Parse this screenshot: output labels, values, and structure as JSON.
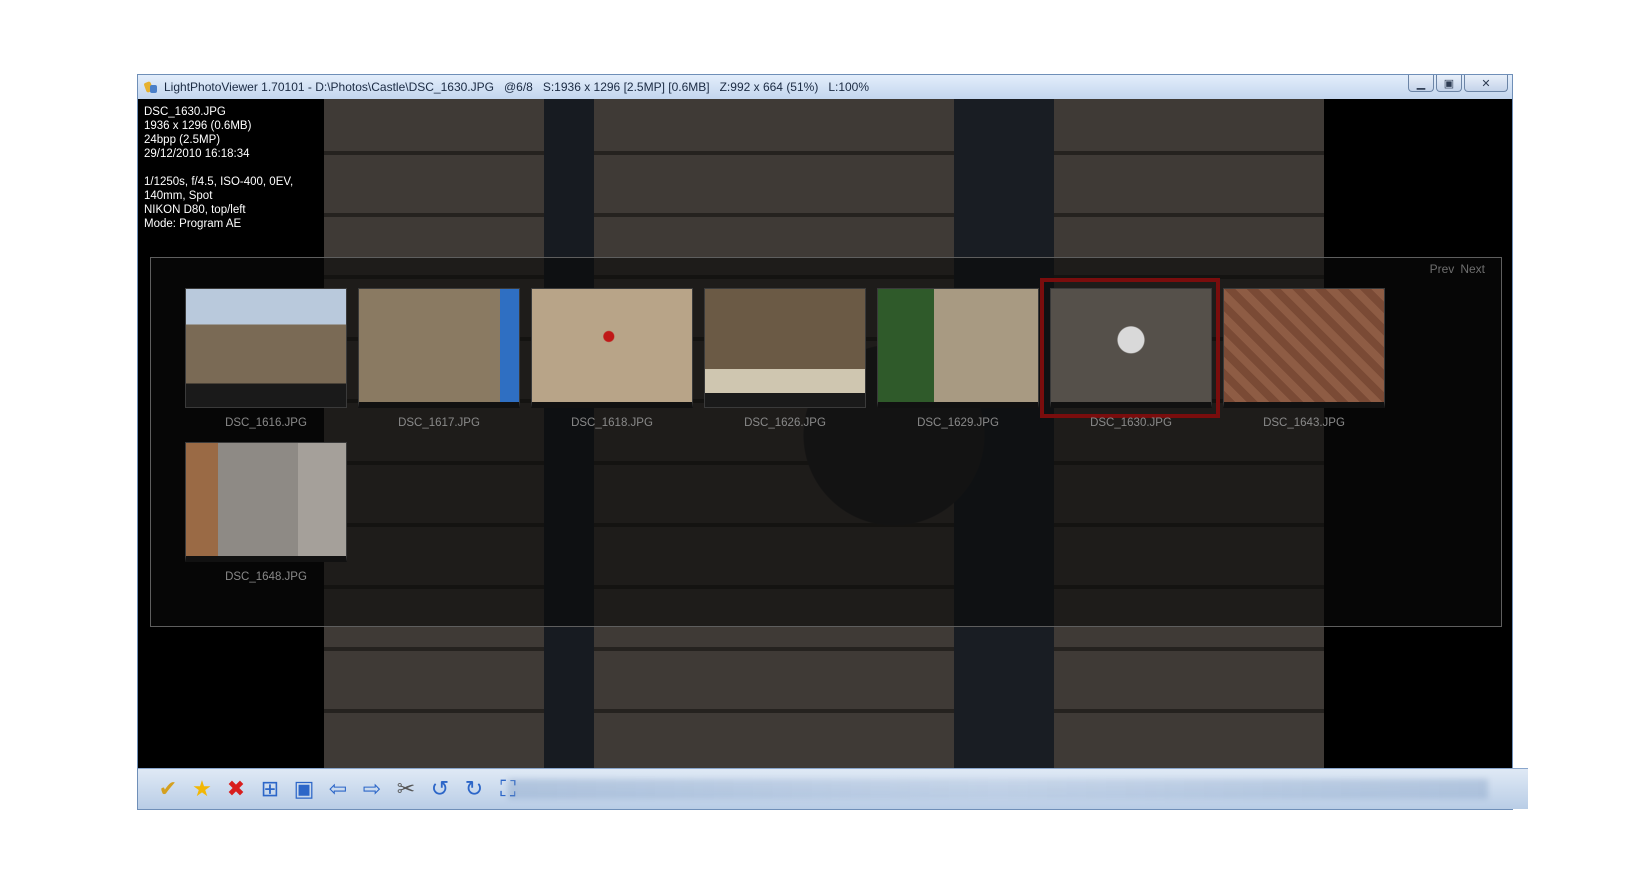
{
  "window": {
    "title": "LightPhotoViewer 1.70101 - D:\\Photos\\Castle\\DSC_1630.JPG   @6/8   S:1936 x 1296 [2.5MP] [0.6MB]   Z:992 x 664 (51%)   L:100%",
    "minimize": "▁",
    "maximize": "▣",
    "close": "✕"
  },
  "info": {
    "lines": [
      "DSC_1630.JPG",
      "1936 x 1296 (0.6MB)",
      "24bpp (2.5MP)",
      "29/12/2010 16:18:34",
      "",
      "1/1250s, f/4.5, ISO-400, 0EV,",
      "140mm, Spot",
      "NIKON D80, top/left",
      "Mode: Program AE"
    ]
  },
  "gallery": {
    "prev": "Prev",
    "next": "Next",
    "thumbs": [
      {
        "name": "DSC_1616.JPG",
        "selected": false
      },
      {
        "name": "DSC_1617.JPG",
        "selected": false
      },
      {
        "name": "DSC_1618.JPG",
        "selected": false
      },
      {
        "name": "DSC_1626.JPG",
        "selected": false
      },
      {
        "name": "DSC_1629.JPG",
        "selected": false
      },
      {
        "name": "DSC_1630.JPG",
        "selected": true
      },
      {
        "name": "DSC_1643.JPG",
        "selected": false
      },
      {
        "name": "DSC_1648.JPG",
        "selected": false
      }
    ]
  },
  "toolbar": {
    "icons": [
      {
        "name": "shield-check-icon",
        "glyph": "✔",
        "color": "#d4a020"
      },
      {
        "name": "star-icon",
        "glyph": "★",
        "color": "#f2b705"
      },
      {
        "name": "delete-icon",
        "glyph": "✖",
        "color": "#d81e1e"
      },
      {
        "name": "grid-icon",
        "glyph": "⊞",
        "color": "#2c66c8"
      },
      {
        "name": "image-icon",
        "glyph": "▣",
        "color": "#2c66c8"
      },
      {
        "name": "arrow-left-icon",
        "glyph": "⇦",
        "color": "#2c66c8"
      },
      {
        "name": "arrow-right-icon",
        "glyph": "⇨",
        "color": "#2c66c8"
      },
      {
        "name": "tools-icon",
        "glyph": "✂",
        "color": "#555555"
      },
      {
        "name": "rotate-left-icon",
        "glyph": "↺",
        "color": "#2c66c8"
      },
      {
        "name": "rotate-right-icon",
        "glyph": "↻",
        "color": "#2c66c8"
      },
      {
        "name": "fit-screen-icon",
        "glyph": "⛶",
        "color": "#2c66c8"
      }
    ]
  }
}
